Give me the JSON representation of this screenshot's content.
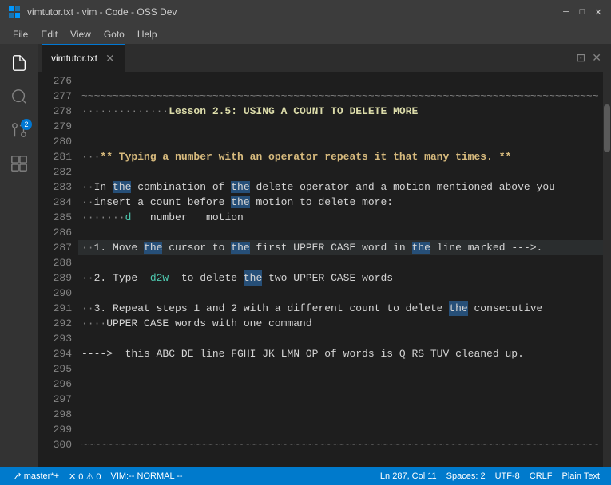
{
  "titleBar": {
    "title": "vimtutor.txt - vim - Code - OSS Dev",
    "icon": "💙",
    "minimizeLabel": "─",
    "maximizeLabel": "□",
    "closeLabel": "✕"
  },
  "menuBar": {
    "items": [
      "File",
      "Edit",
      "View",
      "Goto",
      "Help"
    ]
  },
  "activityBar": {
    "icons": [
      {
        "name": "files-icon",
        "symbol": "⎘",
        "active": true
      },
      {
        "name": "search-icon",
        "symbol": "🔍",
        "active": false
      },
      {
        "name": "source-control-icon",
        "symbol": "⑂",
        "active": false,
        "badge": "2"
      },
      {
        "name": "extensions-icon",
        "symbol": "⊞",
        "active": false
      }
    ]
  },
  "tabBar": {
    "tabs": [
      {
        "label": "vimtutor.txt",
        "active": true,
        "modified": false
      }
    ],
    "icons": [
      "⊡",
      "⊠"
    ]
  },
  "editor": {
    "lines": [
      {
        "num": "276",
        "content": ""
      },
      {
        "num": "277",
        "content": "~~~~~~~~~~~~~~~~~~~~~~~~~~~~~~~~~~~~~~~~~~~~~~~~~~~~~~~~~~~~~~~~~~~~~~~~~~~~~~~~~~~"
      },
      {
        "num": "278",
        "content": "··············Lesson 2.5: USING A COUNT TO DELETE MORE"
      },
      {
        "num": "279",
        "content": ""
      },
      {
        "num": "280",
        "content": ""
      },
      {
        "num": "281",
        "content": "···** Typing a number with an operator repeats it that many times. **"
      },
      {
        "num": "282",
        "content": ""
      },
      {
        "num": "283",
        "content": "··In the combination of the delete operator and a motion mentioned above you"
      },
      {
        "num": "284",
        "content": "··insert a count before the motion to delete more:"
      },
      {
        "num": "285",
        "content": "·······d   number   motion"
      },
      {
        "num": "286",
        "content": ""
      },
      {
        "num": "287",
        "content": "··1. Move the cursor to the first UPPER CASE word in the line marked --->.",
        "highlighted": true
      },
      {
        "num": "288",
        "content": ""
      },
      {
        "num": "289",
        "content": "··2. Type  d2w  to delete the two UPPER CASE words"
      },
      {
        "num": "290",
        "content": ""
      },
      {
        "num": "291",
        "content": "··3. Repeat steps 1 and 2 with a different count to delete the consecutive"
      },
      {
        "num": "292",
        "content": "····UPPER CASE words with one command"
      },
      {
        "num": "293",
        "content": ""
      },
      {
        "num": "294",
        "content": "---->  this ABC DE line FGHI JK LMN OP of words is Q RS TUV cleaned up."
      },
      {
        "num": "295",
        "content": ""
      },
      {
        "num": "296",
        "content": ""
      },
      {
        "num": "297",
        "content": ""
      },
      {
        "num": "298",
        "content": ""
      },
      {
        "num": "299",
        "content": ""
      },
      {
        "num": "300",
        "content": "~~~~~~~~~~~~~~~~~~~~~~~~~~~~~~~~~~~~~~~~~~~~~~~~~~~~~~~~~~~~~~~~~~~~~~~~~~~~~~~~~~~"
      }
    ]
  },
  "statusBar": {
    "left": [
      {
        "name": "branch-item",
        "text": "⎇ master*+"
      },
      {
        "name": "errors-item",
        "text": "✕ 0  ⚠ 0"
      },
      {
        "name": "vim-mode-item",
        "text": "VIM:-- NORMAL --"
      }
    ],
    "right": [
      {
        "name": "position-item",
        "text": "Ln 287, Col 11"
      },
      {
        "name": "spaces-item",
        "text": "Spaces: 2"
      },
      {
        "name": "encoding-item",
        "text": "UTF-8"
      },
      {
        "name": "eol-item",
        "text": "CRLF"
      },
      {
        "name": "language-item",
        "text": "Plain Text"
      }
    ]
  }
}
